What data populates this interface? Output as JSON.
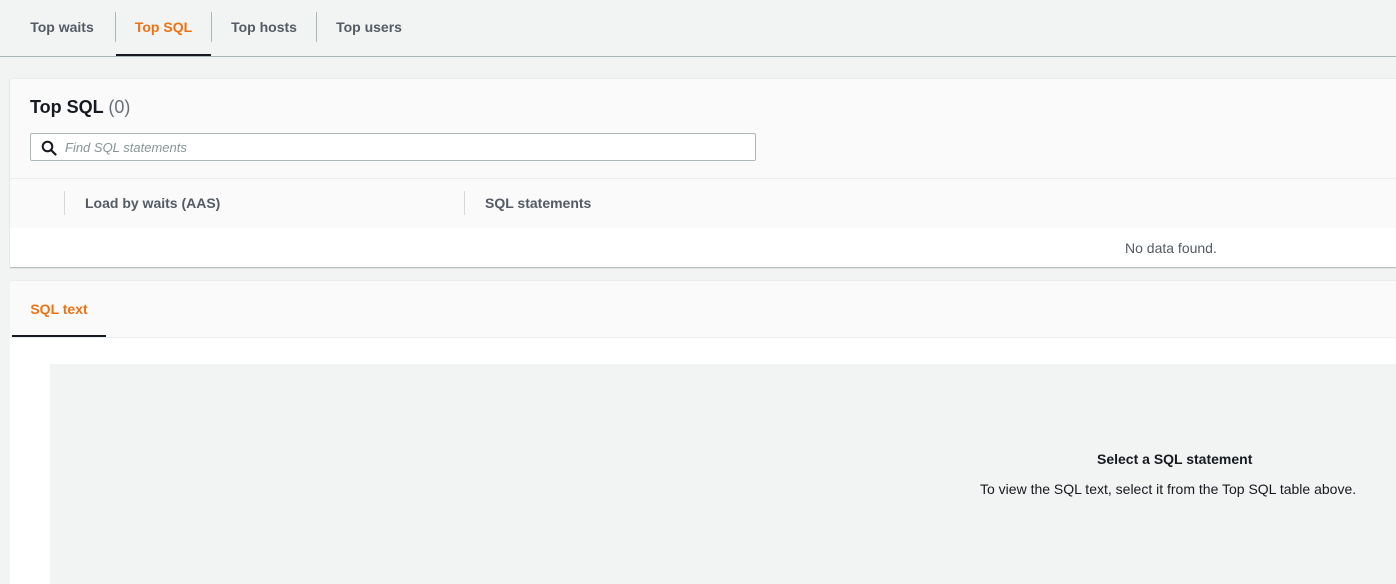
{
  "tabs": [
    {
      "label": "Top waits",
      "active": false
    },
    {
      "label": "Top SQL",
      "active": true
    },
    {
      "label": "Top hosts",
      "active": false
    },
    {
      "label": "Top users",
      "active": false
    }
  ],
  "top_sql": {
    "title": "Top SQL",
    "count": "(0)",
    "search_placeholder": "Find SQL statements",
    "columns": [
      "Load by waits (AAS)",
      "SQL statements"
    ],
    "empty_message": "No data found."
  },
  "sql_text": {
    "tab_label": "SQL text",
    "empty_title": "Select a SQL statement",
    "empty_description": "To view the SQL text, select it from the Top SQL table above."
  },
  "colors": {
    "accent": "#ec7211",
    "text": "#16191f",
    "muted": "#545b64"
  },
  "icons": {
    "search": "search-icon"
  }
}
